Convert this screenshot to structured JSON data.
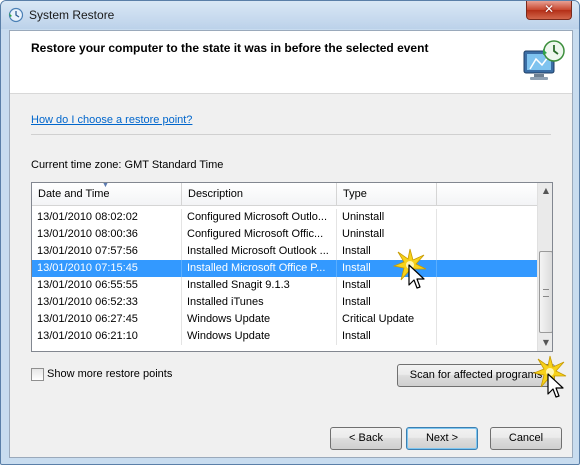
{
  "window": {
    "title": "System Restore"
  },
  "header": {
    "title": "Restore your computer to the state it was in before the selected event"
  },
  "help_link": "How do I choose a restore point?",
  "timezone": "Current time zone: GMT Standard Time",
  "list": {
    "columns": [
      "Date and Time",
      "Description",
      "Type"
    ],
    "sort_column": "Date and Time",
    "rows": [
      {
        "date": "13/01/2010 08:02:02",
        "desc": "Configured Microsoft Outlo...",
        "type": "Uninstall",
        "selected": false
      },
      {
        "date": "13/01/2010 08:00:36",
        "desc": "Configured Microsoft Offic...",
        "type": "Uninstall",
        "selected": false
      },
      {
        "date": "13/01/2010 07:57:56",
        "desc": "Installed Microsoft Outlook ...",
        "type": "Install",
        "selected": false
      },
      {
        "date": "13/01/2010 07:15:45",
        "desc": "Installed Microsoft Office P...",
        "type": "Install",
        "selected": true
      },
      {
        "date": "13/01/2010 06:55:55",
        "desc": "Installed Snagit 9.1.3",
        "type": "Install",
        "selected": false
      },
      {
        "date": "13/01/2010 06:52:33",
        "desc": "Installed iTunes",
        "type": "Install",
        "selected": false
      },
      {
        "date": "13/01/2010 06:27:45",
        "desc": "Windows Update",
        "type": "Critical Update",
        "selected": false
      },
      {
        "date": "13/01/2010 06:21:10",
        "desc": "Windows Update",
        "type": "Install",
        "selected": false
      }
    ]
  },
  "show_more": {
    "label": "Show more restore points",
    "checked": false
  },
  "buttons": {
    "scan": "Scan for affected programs",
    "back": "< Back",
    "next": "Next >",
    "cancel": "Cancel"
  },
  "colors": {
    "selection": "#3399ff",
    "link": "#0066cc",
    "close": "#c7462d"
  },
  "icons": [
    "system-restore-icon",
    "close-icon",
    "restore-monitor-icon",
    "sort-arrow-icon",
    "scroll-up-icon",
    "scroll-down-icon",
    "mouse-cursor-icon",
    "click-burst-icon"
  ]
}
